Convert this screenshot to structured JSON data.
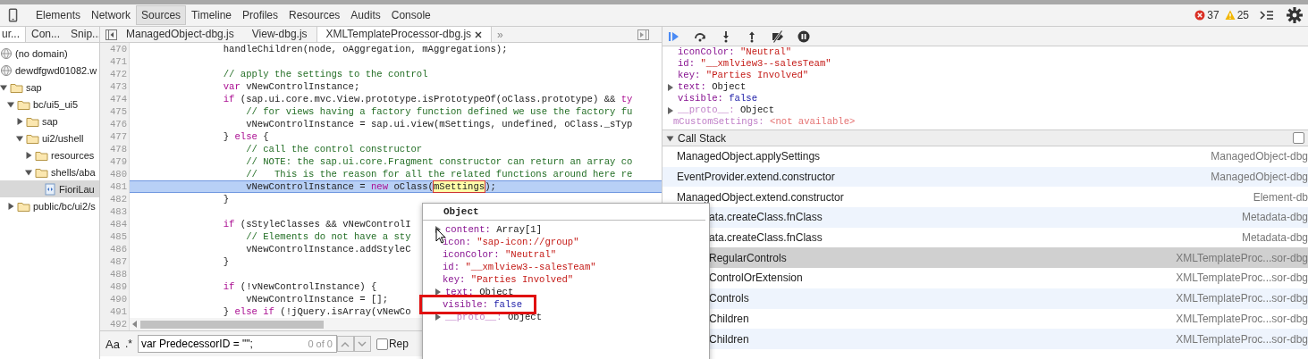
{
  "toolbar": {
    "tabs": [
      {
        "label": "Elements",
        "selected": false
      },
      {
        "label": "Network",
        "selected": false
      },
      {
        "label": "Sources",
        "selected": true
      },
      {
        "label": "Timeline",
        "selected": false
      },
      {
        "label": "Profiles",
        "selected": false
      },
      {
        "label": "Resources",
        "selected": false
      },
      {
        "label": "Audits",
        "selected": false
      },
      {
        "label": "Console",
        "selected": false
      }
    ],
    "error_count": "37",
    "warning_count": "25"
  },
  "navigator": {
    "tabs": [
      {
        "label": "ur...",
        "selected": true
      },
      {
        "label": "Con...",
        "selected": false
      },
      {
        "label": "Snip...",
        "selected": false
      }
    ],
    "tree": [
      {
        "label": "(no domain)",
        "kind": "domain",
        "selected": false
      },
      {
        "label": "dewdfgwd01082.w",
        "kind": "domain",
        "selected": false,
        "children": [
          {
            "label": "sap",
            "kind": "folder",
            "expanded": true,
            "selected": false,
            "children": [
              {
                "label": "bc/ui5_ui5",
                "kind": "folder",
                "expanded": true,
                "selected": false,
                "children": [
                  {
                    "label": "sap",
                    "kind": "folder",
                    "expanded": false,
                    "selected": false
                  },
                  {
                    "label": "ui2/ushell",
                    "kind": "folder",
                    "expanded": true,
                    "selected": false,
                    "children": [
                      {
                        "label": "resources",
                        "kind": "folder",
                        "expanded": false,
                        "selected": false
                      },
                      {
                        "label": "shells/aba",
                        "kind": "folder",
                        "expanded": true,
                        "selected": false,
                        "children": [
                          {
                            "label": "FioriLau",
                            "kind": "file",
                            "selected": true
                          }
                        ]
                      }
                    ]
                  }
                ]
              },
              {
                "label": "public/bc/ui2/s",
                "kind": "folder",
                "expanded": false,
                "selected": false
              }
            ]
          }
        ]
      }
    ]
  },
  "editor": {
    "tabs": [
      {
        "label": "ManagedObject-dbg.js",
        "selected": false
      },
      {
        "label": "View-dbg.js",
        "selected": false
      },
      {
        "label": "XMLTemplateProcessor-dbg.js",
        "selected": true
      }
    ],
    "overflow": "»",
    "lines": [
      {
        "number": "470",
        "current": false,
        "segments": [
          {
            "kind": "plain",
            "text": "                handleChildren(node, oAggregation, mAggregations);"
          }
        ]
      },
      {
        "number": "471",
        "current": false
      },
      {
        "number": "472",
        "current": false,
        "segments": [
          {
            "kind": "comment",
            "text": "                // apply the settings to the control"
          }
        ]
      },
      {
        "number": "473",
        "current": false,
        "segments": [
          {
            "kind": "keyword",
            "text": "                var"
          },
          {
            "kind": "plain",
            "text": " vNewControlInstance;"
          }
        ]
      },
      {
        "number": "474",
        "current": false,
        "segments": [
          {
            "kind": "keyword",
            "text": "                if"
          },
          {
            "kind": "plain",
            "text": " (sap.ui.core.mvc.View.prototype.isPrototypeOf(oClass.prototype) && "
          },
          {
            "kind": "keyword",
            "text": "ty"
          }
        ]
      },
      {
        "number": "475",
        "current": false,
        "segments": [
          {
            "kind": "comment",
            "text": "                    // for views having a factory function defined we use the factory fu"
          }
        ]
      },
      {
        "number": "476",
        "current": false,
        "segments": [
          {
            "kind": "plain",
            "text": "                    vNewControlInstance = sap.ui.view(mSettings, undefined, oClass._sTyp"
          }
        ]
      },
      {
        "number": "477",
        "current": false,
        "segments": [
          {
            "kind": "plain",
            "text": "                } "
          },
          {
            "kind": "keyword",
            "text": "else"
          },
          {
            "kind": "plain",
            "text": " {"
          }
        ]
      },
      {
        "number": "478",
        "current": false,
        "segments": [
          {
            "kind": "comment",
            "text": "                    // call the control constructor"
          }
        ]
      },
      {
        "number": "479",
        "current": false,
        "segments": [
          {
            "kind": "comment",
            "text": "                    // NOTE: the sap.ui.core.Fragment constructor can return an array co"
          }
        ]
      },
      {
        "number": "480",
        "current": false,
        "segments": [
          {
            "kind": "comment",
            "text": "                    //   This is the reason for all the related functions around here re"
          }
        ]
      },
      {
        "number": "481",
        "current": true,
        "segments": [
          {
            "kind": "plain",
            "text": "                    vNewControlInstance = "
          },
          {
            "kind": "keyword",
            "text": "new"
          },
          {
            "kind": "plain",
            "text": " oClass("
          },
          {
            "kind": "hover",
            "text": "mSettings"
          },
          {
            "kind": "plain",
            "text": ");"
          }
        ]
      },
      {
        "number": "482",
        "current": false,
        "segments": [
          {
            "kind": "plain",
            "text": "                }"
          }
        ]
      },
      {
        "number": "483",
        "current": false
      },
      {
        "number": "484",
        "current": false,
        "segments": [
          {
            "kind": "keyword",
            "text": "                if"
          },
          {
            "kind": "plain",
            "text": " (sStyleClasses && vNewControlI"
          }
        ]
      },
      {
        "number": "485",
        "current": false,
        "segments": [
          {
            "kind": "comment",
            "text": "                    // Elements do not have a sty"
          }
        ]
      },
      {
        "number": "486",
        "current": false,
        "segments": [
          {
            "kind": "plain",
            "text": "                    vNewControlInstance.addStyleC"
          }
        ]
      },
      {
        "number": "487",
        "current": false,
        "segments": [
          {
            "kind": "plain",
            "text": "                }"
          }
        ]
      },
      {
        "number": "488",
        "current": false
      },
      {
        "number": "489",
        "current": false,
        "segments": [
          {
            "kind": "keyword",
            "text": "                if"
          },
          {
            "kind": "plain",
            "text": " (!vNewControlInstance) {"
          }
        ]
      },
      {
        "number": "490",
        "current": false,
        "segments": [
          {
            "kind": "plain",
            "text": "                    vNewControlInstance = [];"
          }
        ]
      },
      {
        "number": "491",
        "current": false,
        "segments": [
          {
            "kind": "plain",
            "text": "                } "
          },
          {
            "kind": "keyword",
            "text": "else if"
          },
          {
            "kind": "plain",
            "text": " (!jQuery.isArray(vNewCo"
          }
        ]
      }
    ],
    "last_line_number": "492",
    "search": {
      "case_label": "Aa",
      "regex_label": ".*",
      "value": "var PredecessorID = \"\";",
      "count": "0 of 0",
      "replace_label": "Rep",
      "replace_checked": false
    }
  },
  "scope": [
    {
      "name": "iconColor:",
      "value": "\"Neutral\"",
      "kind": "string"
    },
    {
      "name": "id:",
      "value": "\"__xmlview3--salesTeam\"",
      "kind": "string"
    },
    {
      "name": "key:",
      "value": "\"Parties Involved\"",
      "kind": "string"
    },
    {
      "name": "text:",
      "value": "Object",
      "kind": "object"
    },
    {
      "name": "visible:",
      "value": "false",
      "kind": "boolean"
    },
    {
      "name": "__proto__:",
      "value": "Object",
      "kind": "object"
    },
    {
      "name": "mCustomSettings:",
      "value": "<not available>",
      "kind": "unavailable"
    }
  ],
  "call_stack": {
    "title": "Call Stack",
    "async_checked": false,
    "frames": [
      {
        "function": "ManagedObject.applySettings",
        "location": "ManagedObject-dbg",
        "selected": false,
        "kind": "full"
      },
      {
        "function": "EventProvider.extend.constructor",
        "location": "ManagedObject-dbg",
        "selected": false,
        "kind": "full"
      },
      {
        "function": "ManagedObject.extend.constructor",
        "location": "Element-db",
        "selected": false,
        "kind": "full"
      },
      {
        "function": "ata.createClass.fnClass",
        "location": "Metadata-dbg",
        "selected": false,
        "kind": "clipped"
      },
      {
        "function": "ata.createClass.fnClass",
        "location": "Metadata-dbg",
        "selected": false,
        "kind": "clipped"
      },
      {
        "function": "RegularControls",
        "location": "XMLTemplateProc...sor-dbg",
        "selected": true,
        "kind": "clipped"
      },
      {
        "function": "ControlOrExtension",
        "location": "XMLTemplateProc...sor-dbg",
        "selected": false,
        "kind": "clipped"
      },
      {
        "function": "Controls",
        "location": "XMLTemplateProc...sor-dbg",
        "selected": false,
        "kind": "clipped"
      },
      {
        "function": "Children",
        "location": "XMLTemplateProc...sor-dbg",
        "selected": false,
        "kind": "clipped"
      },
      {
        "function": "Children",
        "location": "XMLTemplateProc...sor-dbg",
        "selected": false,
        "kind": "clipped"
      }
    ]
  },
  "popover": {
    "title": "Object",
    "properties": [
      {
        "name": "content:",
        "value": "Array[1]",
        "kind": "object",
        "highlighted": false
      },
      {
        "name": "icon:",
        "value": "\"sap-icon://group\"",
        "kind": "string",
        "highlighted": false
      },
      {
        "name": "iconColor:",
        "value": "\"Neutral\"",
        "kind": "string",
        "highlighted": false
      },
      {
        "name": "id:",
        "value": "\"__xmlview3--salesTeam\"",
        "kind": "string",
        "highlighted": false
      },
      {
        "name": "key:",
        "value": "\"Parties Involved\"",
        "kind": "string",
        "highlighted": false
      },
      {
        "name": "text:",
        "value": "Object",
        "kind": "object",
        "highlighted": false
      },
      {
        "name": "visible:",
        "value": "false",
        "kind": "boolean",
        "highlighted": true
      },
      {
        "name": "__proto__:",
        "value": "Object",
        "kind": "object",
        "highlighted": false
      }
    ]
  }
}
